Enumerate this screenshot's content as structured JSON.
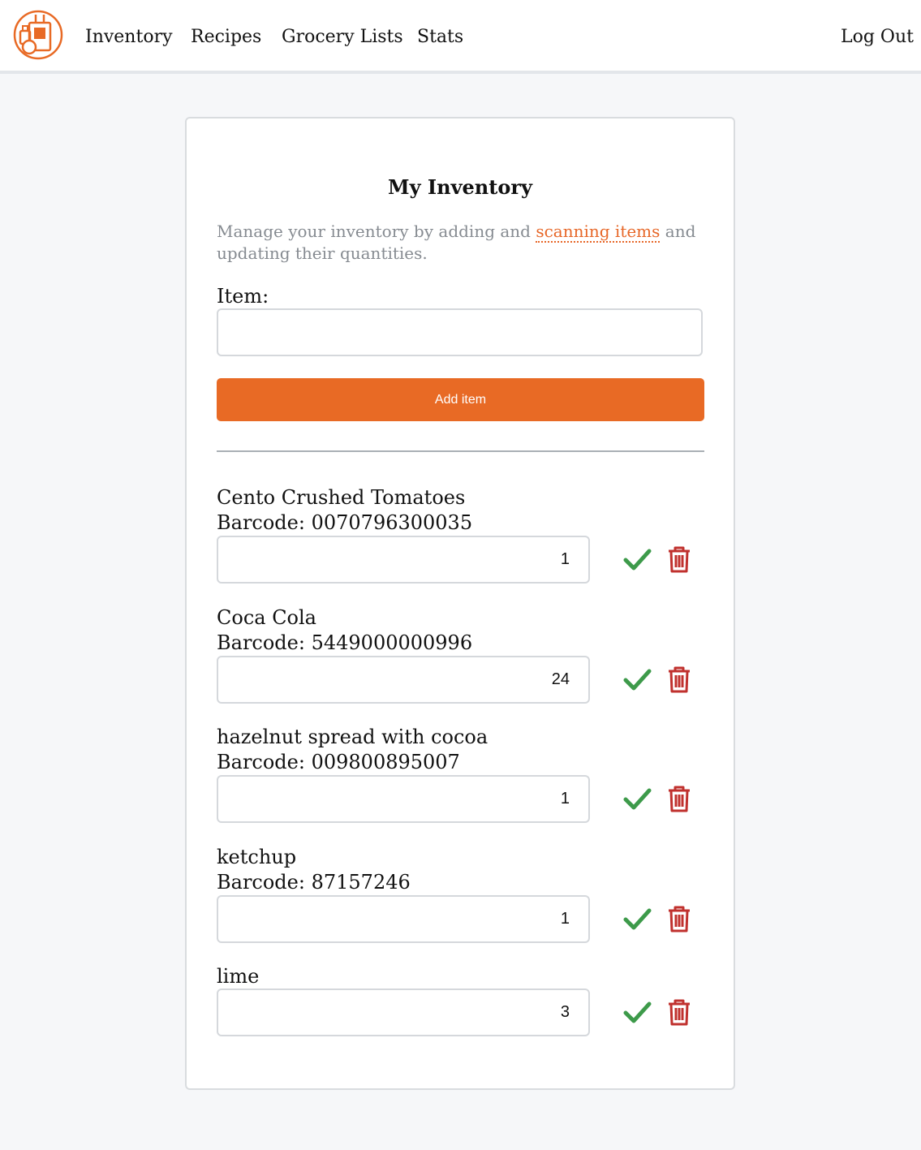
{
  "nav": {
    "logo_icon": "grocery-bag-logo-icon",
    "links": [
      "Inventory",
      "Recipes",
      "Grocery Lists",
      "Stats"
    ],
    "logout": "Log Out"
  },
  "card": {
    "title": "My Inventory",
    "description_before": "Manage your inventory by adding and ",
    "description_link": "scanning items",
    "description_after": " and updating their quantities.",
    "item_label": "Item:",
    "item_input_value": "",
    "add_button": "Add item"
  },
  "inventory": [
    {
      "name": "Cento Crushed Tomatoes",
      "barcode": "Barcode: 0070796300035",
      "quantity": "1"
    },
    {
      "name": "Coca Cola",
      "barcode": "Barcode: 5449000000996",
      "quantity": "24"
    },
    {
      "name": "hazelnut spread with cocoa",
      "barcode": "Barcode: 009800895007",
      "quantity": "1"
    },
    {
      "name": "ketchup",
      "barcode": "Barcode: 87157246",
      "quantity": "1"
    },
    {
      "name": "lime",
      "barcode": "",
      "quantity": "3"
    }
  ],
  "colors": {
    "accent": "#e86a25",
    "check": "#3d9a4a",
    "trash": "#c0312e"
  },
  "icons": {
    "save": "check-icon",
    "delete": "trash-icon"
  }
}
